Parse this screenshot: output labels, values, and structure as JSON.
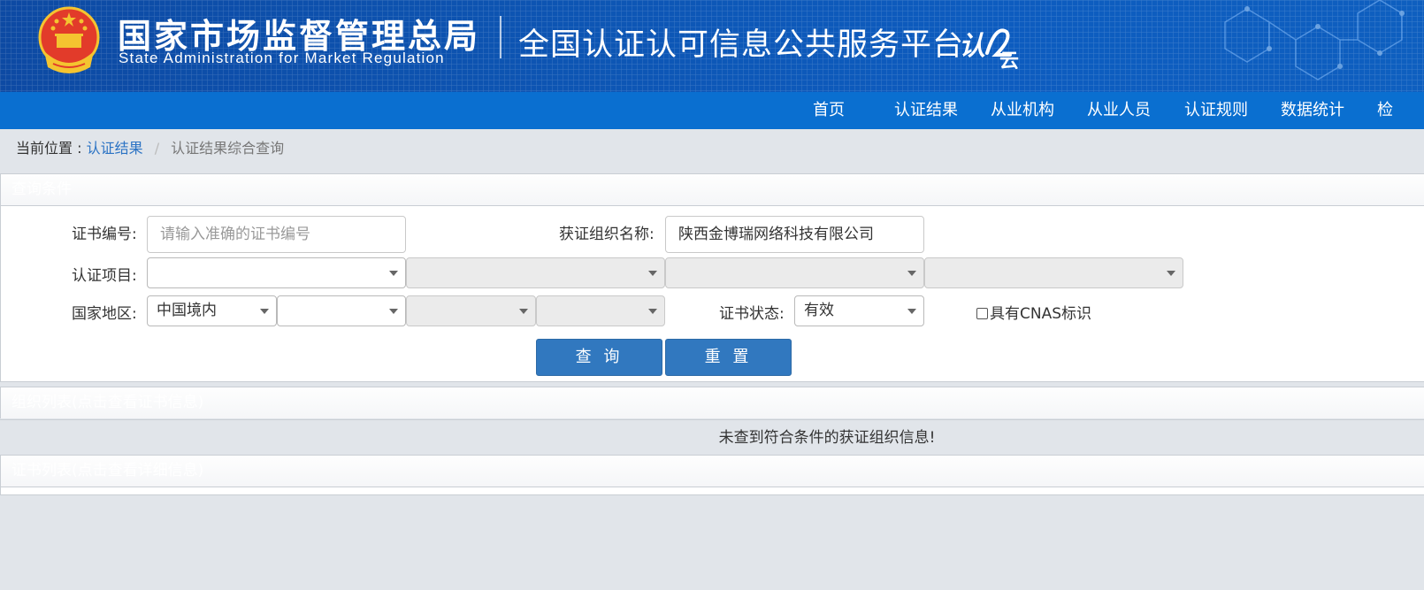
{
  "header": {
    "org_name_cn": "国家市场监督管理总局",
    "org_name_en": "State Administration  for  Market Regulation",
    "platform_title": "全国认证认可信息公共服务平台",
    "logo_text": "认证云"
  },
  "nav": {
    "items": [
      "首页",
      "认证结果",
      "从业机构",
      "从业人员",
      "认证规则",
      "数据统计",
      "检"
    ]
  },
  "breadcrumb": {
    "label": "当前位置 :",
    "link": "认证结果",
    "separator": "/",
    "current": "认证结果综合查询"
  },
  "query_panel": {
    "title": "查询条件",
    "cert_no_label": "证书编号:",
    "cert_no_placeholder": "请输入准确的证书编号",
    "cert_no_value": "",
    "org_name_label": "获证组织名称:",
    "org_name_value": "陕西金博瑞网络科技有限公司",
    "project_label": "认证项目:",
    "project_selects": [
      "",
      "",
      "",
      ""
    ],
    "region_label": "国家地区:",
    "region_selects": [
      "中国境内",
      "",
      "",
      ""
    ],
    "status_label": "证书状态:",
    "status_value": "有效",
    "cnas_label": "具有CNAS标识",
    "search_button": "查 询",
    "reset_button": "重 置"
  },
  "org_panel": {
    "title": "组织列表(点击查看证书信息)",
    "empty_message": "未查到符合条件的获证组织信息!"
  },
  "cert_panel": {
    "title": "证书列表(点击查看详细信息)"
  },
  "colors": {
    "banner": "#0d55b3",
    "nav": "#0a6fd0",
    "button": "#3178bf",
    "background": "#e1e5ea"
  }
}
